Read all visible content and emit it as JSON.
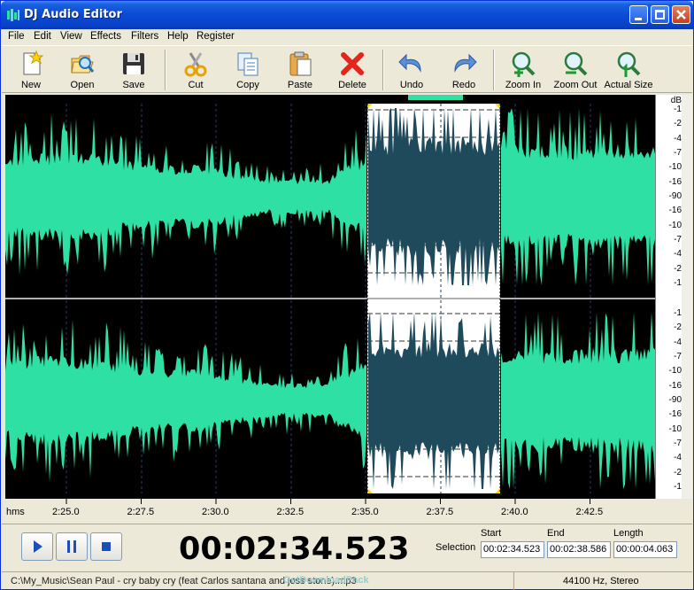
{
  "window": {
    "title": "DJ Audio Editor"
  },
  "menu": [
    "File",
    "Edit",
    "View",
    "Effects",
    "Filters",
    "Help",
    "Register"
  ],
  "toolbar": {
    "new": "New",
    "open": "Open",
    "save": "Save",
    "cut": "Cut",
    "copy": "Copy",
    "paste": "Paste",
    "delete": "Delete",
    "undo": "Undo",
    "redo": "Redo",
    "zoom_in": "Zoom In",
    "zoom_out": "Zoom Out",
    "actual_size": "Actual Size"
  },
  "db_scale": {
    "unit": "dB",
    "top_channel": [
      "-1",
      "-2",
      "-4",
      "-7",
      "-10",
      "-16",
      "-90",
      "-16",
      "-10",
      "-7",
      "-4",
      "-2",
      "-1"
    ],
    "bottom_channel": [
      "-1",
      "-2",
      "-4",
      "-7",
      "-10",
      "-16",
      "-90",
      "-16",
      "-10",
      "-7",
      "-4",
      "-2",
      "-1"
    ]
  },
  "ruler": {
    "unit": "hms",
    "labels": [
      "2:25.0",
      "2:27.5",
      "2:30.0",
      "2:32.5",
      "2:35.0",
      "2:37.5",
      "2:40.0",
      "2:42.5"
    ]
  },
  "colors": {
    "waveform": "#2fe0a5",
    "selection_bg": "#ffffff",
    "selection_wave": "#1f4a5c",
    "background": "#000000"
  },
  "transport": {
    "current_time": "00:02:34.523",
    "selection_label": "Selection",
    "start_label": "Start",
    "end_label": "End",
    "length_label": "Length",
    "start": "00:02:34.523",
    "end": "00:02:38.586",
    "length": "00:00:04.063"
  },
  "status": {
    "path": "C:\\My_Music\\Sean Paul - cry baby cry (feat Carlos santana and joss stone).mp3",
    "watermark": "GetDownloadPack",
    "format": "44100 Hz, Stereo"
  }
}
